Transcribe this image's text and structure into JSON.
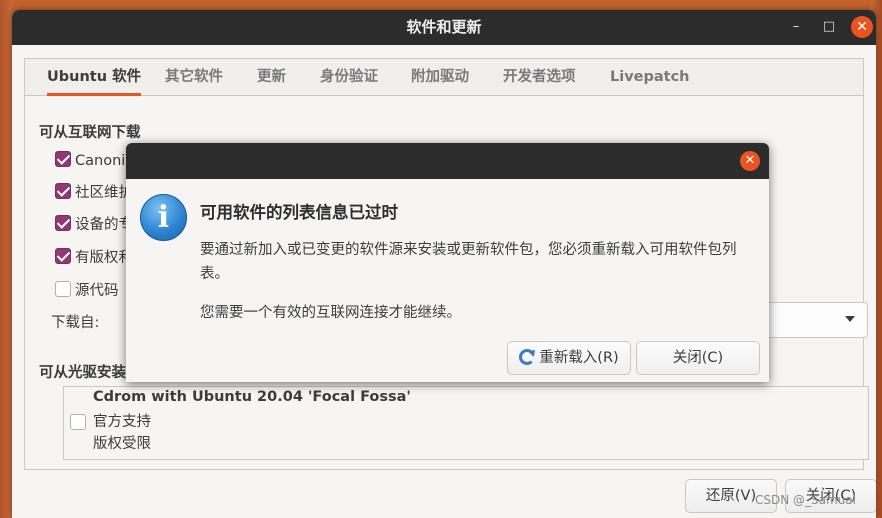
{
  "window": {
    "title": "软件和更新",
    "minimize_glyph": "–",
    "maximize_glyph": "□",
    "close_glyph": "✕"
  },
  "tabs": [
    "Ubuntu 软件",
    "其它软件",
    "更新",
    "身份验证",
    "附加驱动",
    "开发者选项",
    "Livepatch"
  ],
  "download_section": {
    "title": "可从互联网下载",
    "checkboxes": [
      {
        "label": "Canonic",
        "checked": true
      },
      {
        "label": "社区维护",
        "checked": true
      },
      {
        "label": "设备的专",
        "checked": true
      },
      {
        "label": "有版权和",
        "checked": true
      },
      {
        "label": "源代码",
        "checked": false
      }
    ],
    "download_from_label": "下载自:"
  },
  "cdrom_section": {
    "title": "可从光驱安装",
    "lines": [
      "Cdrom with Ubuntu 20.04 'Focal Fossa'",
      "官方支持",
      "版权受限"
    ],
    "checked": false
  },
  "bottom_buttons": {
    "revert": "还原(V)",
    "close": "关闭(C)"
  },
  "dialog": {
    "close_glyph": "✕",
    "icon_glyph": "i",
    "heading": "可用软件的列表信息已过时",
    "body": "要通过新加入或已变更的软件源来安装或更新软件包，您必须重新载入可用软件包列表。",
    "body2": "您需要一个有效的互联网连接才能继续。",
    "reload_button": "重新载入(R)",
    "close_button": "关闭(C)"
  },
  "watermark": "CSDN @_Samual",
  "colors": {
    "accent": "#e95420",
    "checkbox": "#8e3a6e",
    "titlebar": "#2c2c2c",
    "info_icon": "#2f86d3"
  }
}
